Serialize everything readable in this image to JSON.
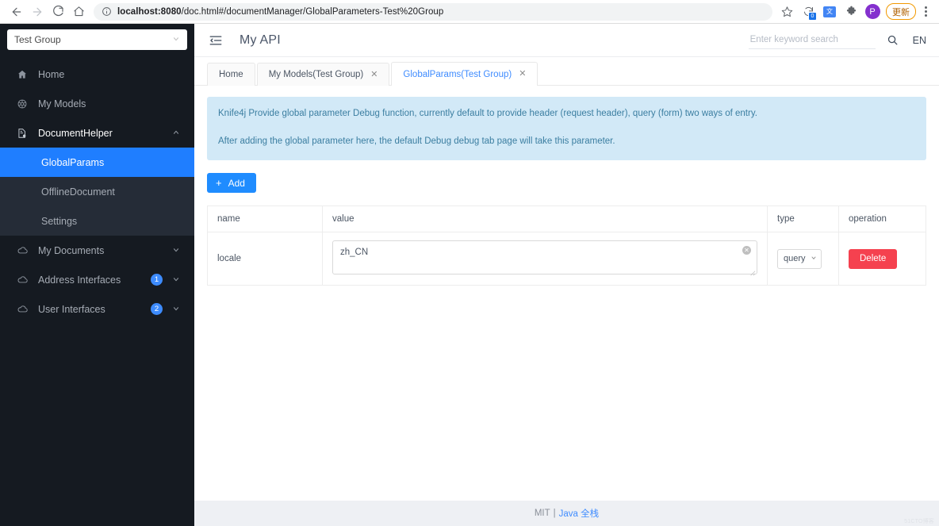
{
  "browser": {
    "url_display": "localhost:8080/doc.html#/documentManager/GlobalParameters-Test%20Group",
    "url_host": "localhost:8080",
    "url_path": "/doc.html#/documentManager/GlobalParameters-Test%20Group",
    "sync_badge": "0",
    "translate_label": "文",
    "profile_initial": "P",
    "update_label": "更新"
  },
  "sidebar": {
    "group_selector": {
      "value": "Test Group"
    },
    "items": [
      {
        "label": "Home",
        "icon": "home-icon",
        "badge": "",
        "caret": ""
      },
      {
        "label": "My Models",
        "icon": "models-icon",
        "badge": "",
        "caret": ""
      },
      {
        "label": "DocumentHelper",
        "icon": "document-gear-icon",
        "badge": "",
        "caret": "up"
      },
      {
        "label": "My Documents",
        "icon": "cloud-icon",
        "badge": "",
        "caret": "down"
      },
      {
        "label": "Address Interfaces",
        "icon": "cloud-icon",
        "badge": "1",
        "caret": "down"
      },
      {
        "label": "User Interfaces",
        "icon": "cloud-icon",
        "badge": "2",
        "caret": "down"
      }
    ],
    "submenu": [
      {
        "label": "GlobalParams",
        "active": true
      },
      {
        "label": "OfflineDocument",
        "active": false
      },
      {
        "label": "Settings",
        "active": false
      }
    ]
  },
  "header": {
    "title": "My API",
    "fold_icon": "menu-fold-icon",
    "search_placeholder": "Enter keyword search",
    "search_value": "",
    "search_icon": "search-icon",
    "language": "EN"
  },
  "tabs": [
    {
      "label": "Home",
      "closable": false,
      "active": false
    },
    {
      "label": "My Models(Test Group)",
      "closable": true,
      "active": false
    },
    {
      "label": "GlobalParams(Test Group)",
      "closable": true,
      "active": true
    }
  ],
  "alert": {
    "line1": "Knife4j Provide global parameter Debug function, currently default to provide header (request header), query (form) two ways of entry.",
    "line2": "After adding the global parameter here, the default Debug debug tab page will take this parameter."
  },
  "toolbar": {
    "add_label": "Add",
    "add_icon": "plus-icon"
  },
  "table": {
    "columns": [
      "name",
      "value",
      "type",
      "operation"
    ],
    "rows": [
      {
        "name": "locale",
        "value": "zh_CN",
        "type": "query",
        "delete_label": "Delete"
      }
    ]
  },
  "footer": {
    "license": "MIT",
    "separator": "|",
    "link": "Java 全栈",
    "watermark": "51CTO博客"
  },
  "colors": {
    "accent": "#1f8cff",
    "sidebar_bg": "#151a21",
    "submenu_bg": "#252c37",
    "active_item": "#1f7eff",
    "alert_bg": "#d2e9f7",
    "alert_text": "#3b7ea1",
    "danger": "#f5414f",
    "footer_bg": "#eef0f4",
    "update_border": "#f29900",
    "avatar_bg": "#8430ce"
  }
}
